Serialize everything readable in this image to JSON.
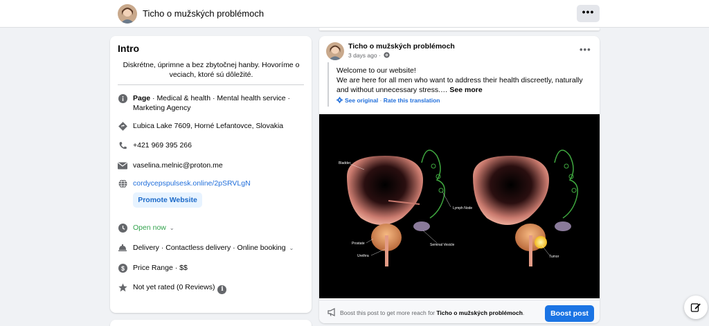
{
  "header": {
    "page_name": "Ticho o mužských problémoch",
    "more_label": "•••"
  },
  "intro": {
    "title": "Intro",
    "bio": "Diskrétne, úprimne a bez zbytočnej hanby. Hovoríme o veciach, ktoré sú dôležité.",
    "category_prefix": "Page",
    "categories": " · Medical & health · Mental health service · Marketing Agency",
    "address": "Ľubica Lake 7609, Horné Lefantovce, Slovakia",
    "phone": "+421 969 395 266",
    "email": "vaselina.melnic@proton.me",
    "website": "cordycepspulsesk.online/2pSRVLgN",
    "promote_label": "Promote Website",
    "hours": "Open now",
    "services": "Delivery · Contactless delivery · Online booking",
    "price": "Price Range · $$",
    "rating": "Not yet rated (0 Reviews)",
    "icons": [
      "info-icon",
      "location-icon",
      "phone-icon",
      "email-icon",
      "globe-icon",
      "clock-icon",
      "service-bell-icon",
      "dollar-icon",
      "star-icon",
      "info-icon"
    ]
  },
  "post": {
    "author": "Ticho o mužských problémoch",
    "time": "3 days ago ·",
    "more_label": "•••",
    "text": "Welcome to our website!\nWe are here for all men who want to address their health discreetly, naturally and without unnecessary stress.… ",
    "see_more": "See more",
    "see_original": "See original",
    "translation_sep": " · ",
    "rate_translation": "Rate this translation",
    "image_labels": {
      "bladder": "Bladder",
      "lymph_node": "Lymph Node",
      "prostate": "Prostate",
      "seminal_vesicle": "Seminal Vesicle",
      "urethra": "Urethra",
      "tumor": "Tumor"
    },
    "boost_text_prefix": "Boost this post to get more reach for ",
    "boost_text_name": "Ticho o mužských problémoch",
    "boost_text_suffix": ".",
    "boost_button": "Boost post"
  },
  "colors": {
    "accent": "#1b74e4",
    "link": "#216fdb",
    "open_now": "#31a24c",
    "background": "#f0f2f5"
  }
}
